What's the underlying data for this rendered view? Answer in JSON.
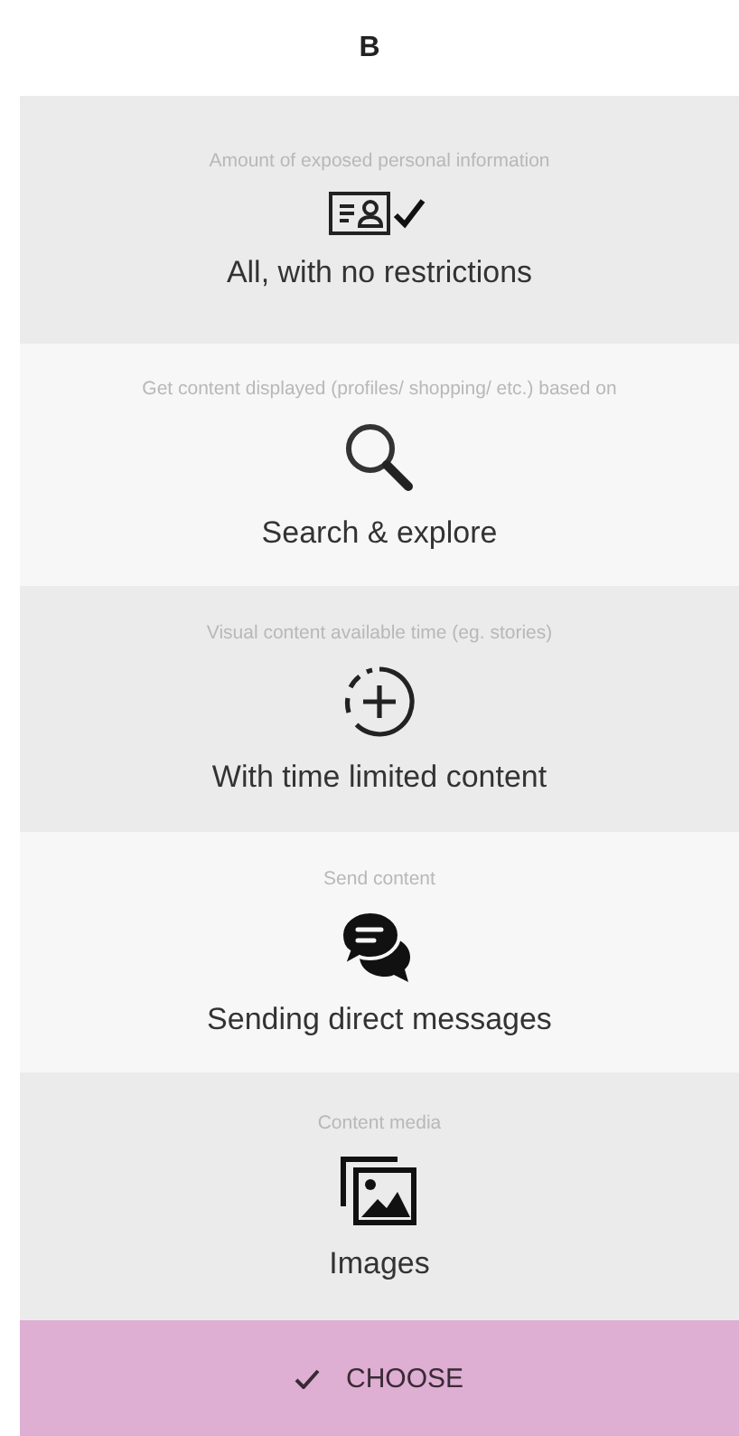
{
  "title": "B",
  "sections": [
    {
      "caption": "Amount of exposed personal information",
      "kind": "profile",
      "value": "All, with no restrictions"
    },
    {
      "caption": "Get content displayed (profiles/ shopping/ etc.) based on",
      "kind": "search",
      "value": "Search & explore"
    },
    {
      "caption": "Visual content available time (eg. stories)",
      "kind": "story",
      "value": "With time limited content"
    },
    {
      "caption": "Send content",
      "kind": "message",
      "value": "Sending direct messages"
    },
    {
      "caption": "Content media",
      "kind": "media",
      "value": "Images"
    }
  ],
  "button": {
    "label": "CHOOSE"
  }
}
